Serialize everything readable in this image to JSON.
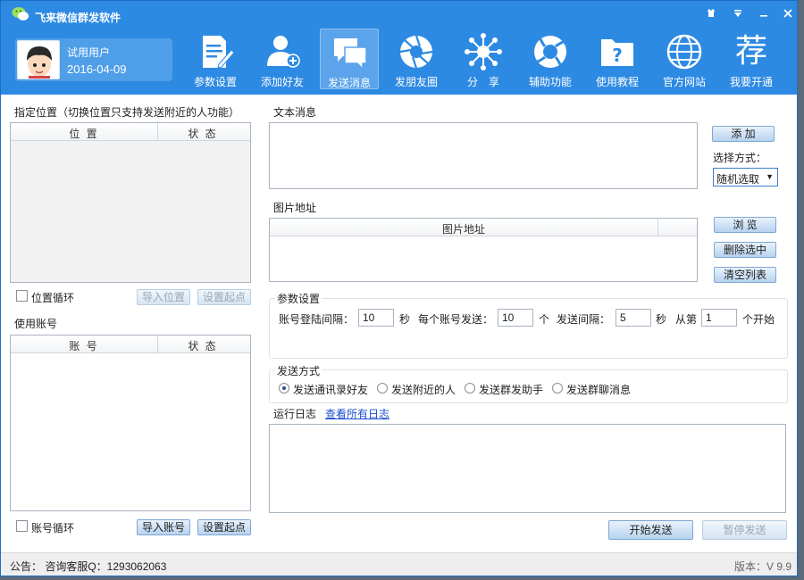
{
  "window": {
    "title": "飞来微信群发软件"
  },
  "user": {
    "name": "试用用户",
    "date": "2016-04-09"
  },
  "nav": [
    {
      "label": "参数设置",
      "icon": "document-edit-icon"
    },
    {
      "label": "添加好友",
      "icon": "add-user-icon"
    },
    {
      "label": "发送消息",
      "icon": "chat-bubbles-icon"
    },
    {
      "label": "发朋友圈",
      "icon": "aperture-icon"
    },
    {
      "label": "分　享",
      "icon": "share-network-icon"
    },
    {
      "label": "辅助功能",
      "icon": "lifebuoy-icon"
    },
    {
      "label": "使用教程",
      "icon": "help-folder-icon"
    },
    {
      "label": "官方网站",
      "icon": "globe-icon"
    },
    {
      "label": "我要开通",
      "icon": "recommend-char-icon",
      "glyph": "荐"
    }
  ],
  "location": {
    "title": "指定位置（切换位置只支持发送附近的人功能）",
    "columns": [
      "位 置",
      "状 态"
    ],
    "loop_label": "位置循环",
    "import_button": "导入位置",
    "set_start_button": "设置起点"
  },
  "accounts": {
    "title": "使用账号",
    "columns": [
      "账 号",
      "状 态"
    ],
    "loop_label": "账号循环",
    "import_button": "导入账号",
    "set_start_button": "设置起点"
  },
  "text_message": {
    "label": "文本消息",
    "add_button": "添 加",
    "select_label": "选择方式：",
    "select_value": "随机选取"
  },
  "image": {
    "label": "图片地址",
    "column": "图片地址",
    "browse_button": "浏 览",
    "delete_button": "删除选中",
    "clear_button": "清空列表"
  },
  "params": {
    "title": "参数设置",
    "login_interval_label": "账号登陆间隔：",
    "login_interval": "10",
    "unit_sec": "秒",
    "per_account_label": "每个账号发送：",
    "per_account": "10",
    "unit_count": "个",
    "send_interval_label": "发送间隔：",
    "send_interval": "5",
    "from_label": "从第",
    "from_value": "1",
    "start_suffix": "个开始"
  },
  "send_mode": {
    "title": "发送方式",
    "options": [
      "发送通讯录好友",
      "发送附近的人",
      "发送群发助手",
      "发送群聊消息"
    ],
    "selected": 0
  },
  "log": {
    "label": "运行日志",
    "link": "查看所有日志"
  },
  "actions": {
    "start_button": "开始发送",
    "pause_button": "暂停发送"
  },
  "status": {
    "notice": "公告：  咨询客服Q：1293062063",
    "version": "版本：V 9.9"
  },
  "colors": {
    "header": "#2d8ae3",
    "accent": "#1a4fd0"
  }
}
